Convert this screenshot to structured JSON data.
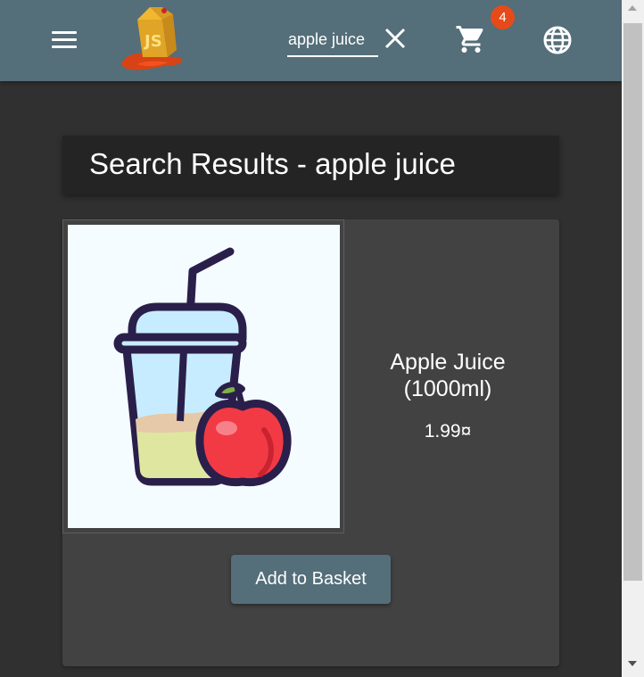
{
  "toolbar": {
    "search": {
      "value": "apple juice"
    },
    "cart": {
      "count": "4",
      "badge_color": "#e64a19"
    },
    "background_color": "#546e7a",
    "icons": [
      "menu-icon",
      "juice-shop-logo",
      "close-icon",
      "shopping-cart-icon",
      "language-globe-icon"
    ]
  },
  "heading": {
    "text": "Search Results - apple juice"
  },
  "product": {
    "name": "Apple Juice (1000ml)",
    "price": "1.99¤",
    "image_icon": "apple-juice-image",
    "add_button_label": "Add to Basket"
  },
  "colors": {
    "page_background": "#303030",
    "card_background": "#424242",
    "accent": "#546e7a"
  }
}
